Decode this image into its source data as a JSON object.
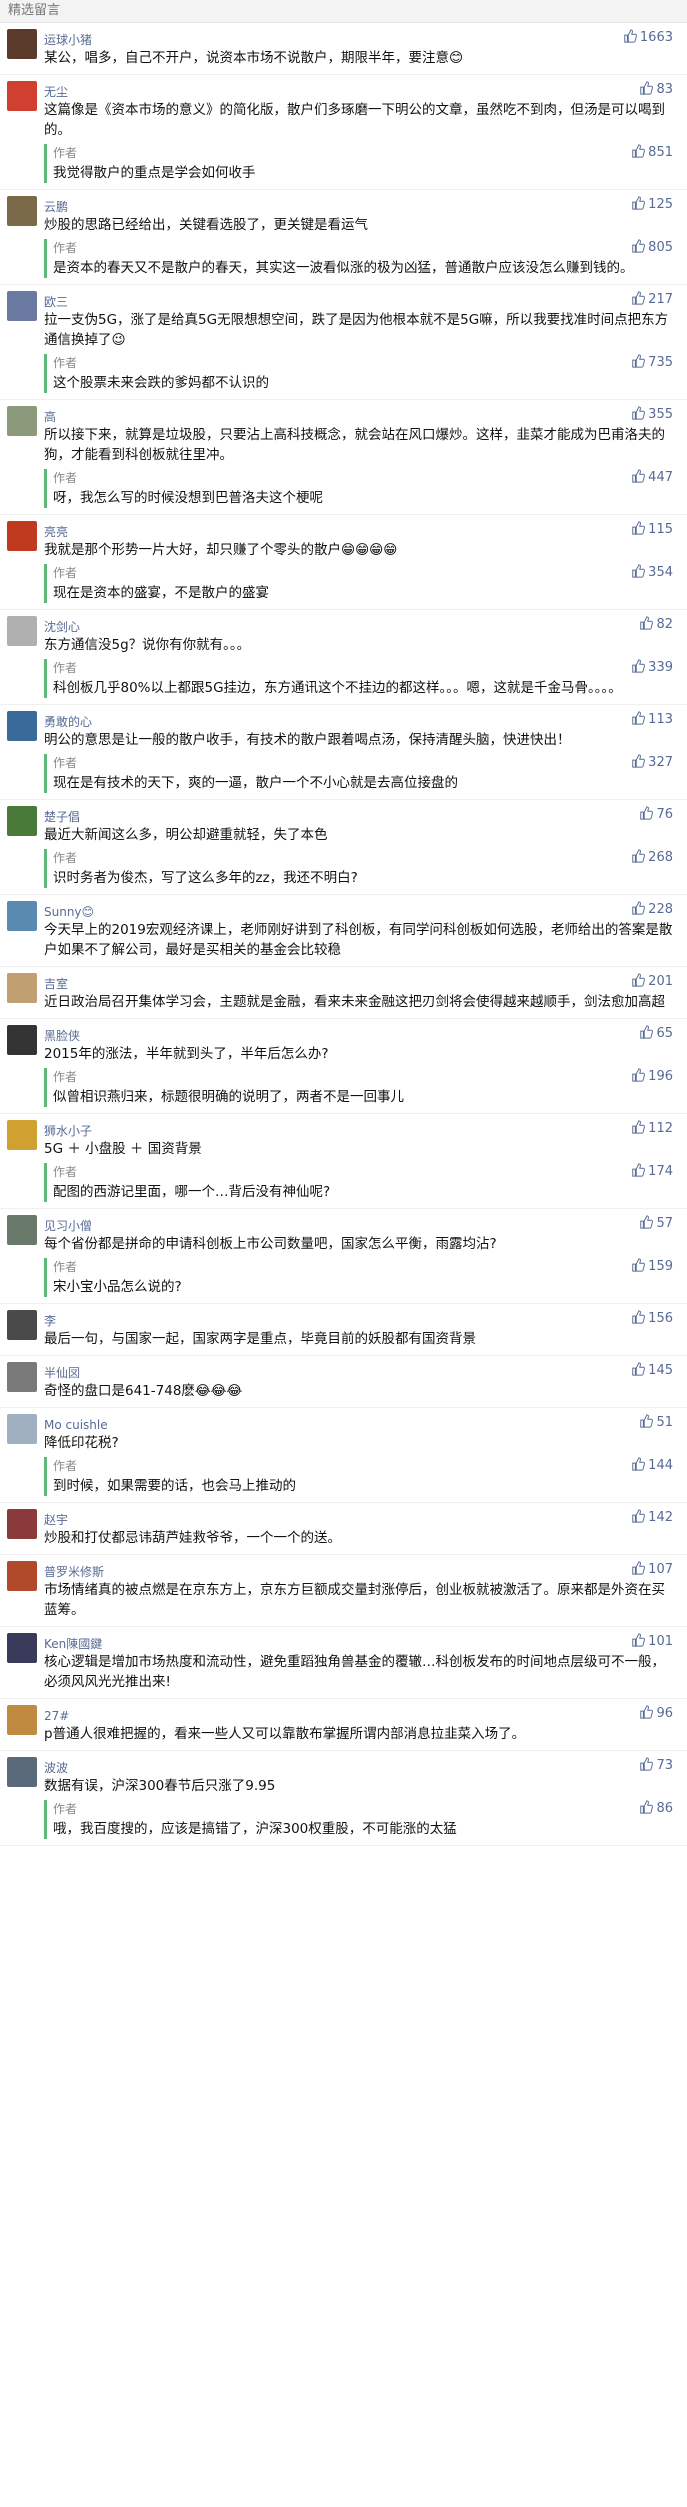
{
  "header": {
    "title": "精选留言"
  },
  "comments": [
    {
      "name": "运球小猪",
      "likes": "1663",
      "text": "某公，唱多，自己不开户，说资本市场不说散户，期限半年，要注意😊",
      "avatar_color": "#5a3a2a"
    },
    {
      "name": "无尘",
      "likes": "83",
      "text": "这篇像是《资本市场的意义》的简化版，散户们多琢磨一下明公的文章，虽然吃不到肉，但汤是可以喝到的。",
      "reply_label": "作者",
      "reply_likes": "851",
      "reply_text": "我觉得散户的重点是学会如何收手",
      "avatar_color": "#d04030"
    },
    {
      "name": "云鹏",
      "likes": "125",
      "text": "炒股的思路已经给出，关键看选股了，更关键是看运气",
      "reply_label": "作者",
      "reply_likes": "805",
      "reply_text": "是资本的春天又不是散户的春天，其实这一波看似涨的极为凶猛，普通散户应该没怎么赚到钱的。",
      "avatar_color": "#7a6a4a"
    },
    {
      "name": "欧三",
      "likes": "217",
      "text": "拉一支伪5G，涨了是给真5G无限想想空间，跌了是因为他根本就不是5G嘛，所以我要找准时间点把东方通信换掉了😉",
      "reply_label": "作者",
      "reply_likes": "735",
      "reply_text": "这个股票未来会跌的爹妈都不认识的",
      "avatar_color": "#6a7aa0"
    },
    {
      "name": "高",
      "likes": "355",
      "text": "所以接下来，就算是垃圾股，只要沾上高科技概念，就会站在风口爆炒。这样，韭菜才能成为巴甫洛夫的狗，才能看到科创板就往里冲。",
      "reply_label": "作者",
      "reply_likes": "447",
      "reply_text": "呀，我怎么写的时候没想到巴普洛夫这个梗呢",
      "avatar_color": "#8a9a7a"
    },
    {
      "name": "亮亮",
      "likes": "115",
      "text": "我就是那个形势一片大好，却只赚了个零头的散户😁😁😁😁",
      "reply_label": "作者",
      "reply_likes": "354",
      "reply_text": "现在是资本的盛宴，不是散户的盛宴",
      "avatar_color": "#c03a20"
    },
    {
      "name": "沈剑心",
      "likes": "82",
      "text": "东方通信没5g？说你有你就有。。。",
      "reply_label": "作者",
      "reply_likes": "339",
      "reply_text": "科创板几乎80%以上都跟5G挂边，东方通讯这个不挂边的都这样。。。嗯，这就是千金马骨。。。。",
      "avatar_color": "#b0b0b0"
    },
    {
      "name": "勇敢的心",
      "likes": "113",
      "text": "明公的意思是让一般的散户收手，有技术的散户跟着喝点汤，保持清醒头脑，快进快出！",
      "reply_label": "作者",
      "reply_likes": "327",
      "reply_text": "现在是有技术的天下，爽的一逼，散户一个不小心就是去高位接盘的",
      "avatar_color": "#3a6a9a"
    },
    {
      "name": "楚子倡",
      "likes": "76",
      "text": "最近大新闻这么多，明公却避重就轻，失了本色",
      "reply_label": "作者",
      "reply_likes": "268",
      "reply_text": "识时务者为俊杰，写了这么多年的zz，我还不明白?",
      "avatar_color": "#4a7a3a"
    },
    {
      "name": "Sunny😊",
      "likes": "228",
      "text": "今天早上的2019宏观经济课上，老师刚好讲到了科创板，有同学问科创板如何选股，老师给出的答案是散户如果不了解公司，最好是买相关的基金会比较稳",
      "avatar_color": "#5a8ab0"
    },
    {
      "name": "吉室",
      "likes": "201",
      "text": "近日政治局召开集体学习会，主题就是金融，看来未来金融这把刃剑将会使得越来越顺手，剑法愈加高超",
      "avatar_color": "#c0a070"
    },
    {
      "name": "黑脸侠",
      "likes": "65",
      "text": "2015年的涨法，半年就到头了，半年后怎么办?",
      "reply_label": "作者",
      "reply_likes": "196",
      "reply_text": "似曾相识燕归来，标题很明确的说明了，两者不是一回事儿",
      "avatar_color": "#333333"
    },
    {
      "name": "狮水小子",
      "likes": "112",
      "text": "5G ＋ 小盘股 ＋ 国资背景",
      "reply_label": "作者",
      "reply_likes": "174",
      "reply_text": "配图的西游记里面，哪一个…背后没有神仙呢?",
      "avatar_color": "#d0a030"
    },
    {
      "name": "见习小僧",
      "likes": "57",
      "text": "每个省份都是拼命的申请科创板上市公司数量吧，国家怎么平衡，雨露均沾?",
      "reply_label": "作者",
      "reply_likes": "159",
      "reply_text": "宋小宝小品怎么说的?",
      "avatar_color": "#6a7a6a"
    },
    {
      "name": "李",
      "likes": "156",
      "text": "最后一句，与国家一起，国家两字是重点，毕竟目前的妖股都有国资背景",
      "avatar_color": "#4a4a4a"
    },
    {
      "name": "半仙㘝",
      "likes": "145",
      "text": "奇怪的盘口是641-748麽😂😂😂",
      "avatar_color": "#7a7a7a"
    },
    {
      "name": "Mo cuishle",
      "likes": "51",
      "text": "降低印花税?",
      "reply_label": "作者",
      "reply_likes": "144",
      "reply_text": "到时候，如果需要的话，也会马上推动的",
      "avatar_color": "#a0b0c0"
    },
    {
      "name": "赵宇",
      "likes": "142",
      "text": "炒股和打仗都忌讳葫芦娃救爷爷，一个一个的送。",
      "avatar_color": "#8a3a3a"
    },
    {
      "name": "普罗米修斯",
      "likes": "107",
      "text": "市场情绪真的被点燃是在京东方上，京东方巨额成交量封涨停后，创业板就被激活了。原来都是外资在买蓝筹。",
      "avatar_color": "#b04a2a"
    },
    {
      "name": "Ken陳國鍵",
      "likes": "101",
      "text": "核心逻辑是增加市场热度和流动性，避免重蹈独角兽基金的覆辙…科创板发布的时间地点层级可不一般，必须风风光光推出来!",
      "avatar_color": "#3a3a5a"
    },
    {
      "name": "27#",
      "likes": "96",
      "text": "p普通人很难把握的，看来一些人又可以靠散布掌握所谓内部消息拉韭菜入场了。",
      "avatar_color": "#c08a40"
    },
    {
      "name": "波波",
      "likes": "73",
      "text": "数据有误，沪深300春节后只涨了9.95",
      "reply_label": "作者",
      "reply_likes": "86",
      "reply_text": "哦，我百度搜的，应该是搞错了，沪深300权重股，不可能涨的太猛",
      "avatar_color": "#5a6a7a"
    }
  ]
}
